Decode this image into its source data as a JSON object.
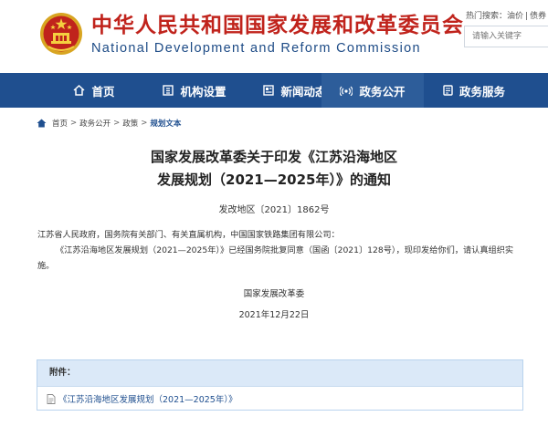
{
  "header": {
    "title_cn": "中华人民共和国国家发展和改革委员会",
    "title_en": "National Development and Reform Commission",
    "hot_label": "热门搜索：",
    "hot_items": [
      "油价",
      "债券"
    ],
    "search_placeholder": "请输入关键字"
  },
  "nav": {
    "items": [
      {
        "label": "首页",
        "icon": "home-icon"
      },
      {
        "label": "机构设置",
        "icon": "building-icon"
      },
      {
        "label": "新闻动态",
        "icon": "news-icon"
      },
      {
        "label": "政务公开",
        "icon": "broadcast-icon",
        "active": true
      },
      {
        "label": "政务服务",
        "icon": "document-icon"
      }
    ]
  },
  "breadcrumb": [
    "首页",
    "政务公开",
    "政策",
    "规划文本"
  ],
  "article": {
    "title_line1": "国家发展改革委关于印发《江苏沿海地区",
    "title_line2": "发展规划（2021—2025年）》的通知",
    "doc_number": "发改地区〔2021〕1862号",
    "para1": "江苏省人民政府，国务院有关部门、有关直属机构，中国国家铁路集团有限公司：",
    "para2": "《江苏沿海地区发展规划（2021—2025年）》已经国务院批复同意（国函〔2021〕128号），现印发给你们，请认真组织实施。",
    "signer": "国家发展改革委",
    "date": "2021年12月22日"
  },
  "attachments": {
    "heading": "附件：",
    "files": [
      "《江苏沿海地区发展规划（2021—2025年）》"
    ]
  },
  "colors": {
    "brand_red": "#c0231c",
    "nav_blue": "#1f4f8f",
    "english_title_blue": "#1d4b86",
    "attach_header_bg": "#dbe9f8"
  }
}
